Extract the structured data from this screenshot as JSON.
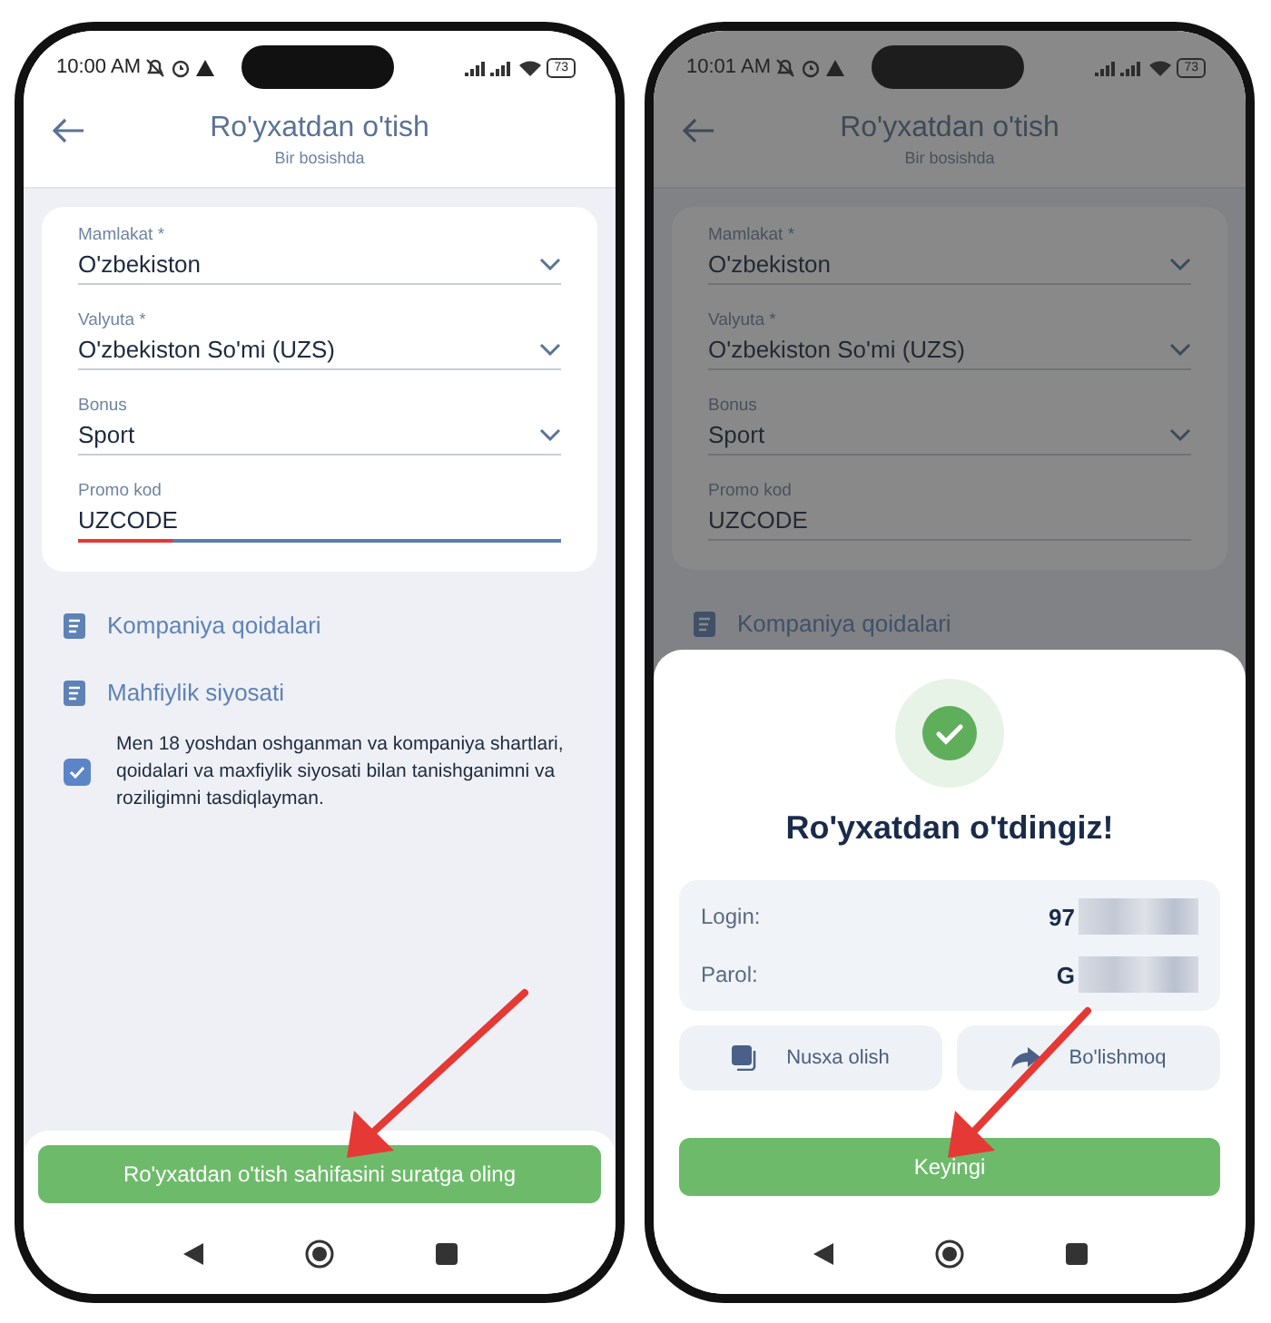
{
  "phones": [
    {
      "kind": "form",
      "dimmed": false,
      "status_bar": {
        "time": "10:00 AM",
        "battery": "73"
      },
      "header": {
        "title": "Ro'yxatdan o'tish",
        "subtitle": "Bir bosishda"
      },
      "fields": [
        {
          "kind": "select",
          "label": "Mamlakat *",
          "value": "O'zbekiston",
          "focused": false
        },
        {
          "kind": "select",
          "label": "Valyuta *",
          "value": "O'zbekiston So'mi (UZS)",
          "focused": false
        },
        {
          "kind": "select",
          "label": "Bonus",
          "value": "Sport",
          "focused": false
        },
        {
          "kind": "text",
          "label": "Promo kod",
          "value": "UZCODE",
          "focused": true
        }
      ],
      "links": [
        "Kompaniya qoidalari",
        "Mahfiylik siyosati"
      ],
      "agreement": {
        "text": "Men 18 yoshdan oshganman va kompaniya shartlari, qoidalari va maxfiylik siyosati bilan tanishganimni va roziligimni tasdiqlayman.",
        "checked": true
      },
      "footer_button": "Ro'yxatdan o'tish sahifasini suratga oling"
    },
    {
      "kind": "dialog",
      "dimmed": true,
      "status_bar": {
        "time": "10:01 AM",
        "battery": "73"
      },
      "header": {
        "title": "Ro'yxatdan o'tish",
        "subtitle": "Bir bosishda"
      },
      "fields": [
        {
          "kind": "select",
          "label": "Mamlakat *",
          "value": "O'zbekiston",
          "focused": false
        },
        {
          "kind": "select",
          "label": "Valyuta *",
          "value": "O'zbekiston So'mi (UZS)",
          "focused": false
        },
        {
          "kind": "select",
          "label": "Bonus",
          "value": "Sport",
          "focused": false
        },
        {
          "kind": "text",
          "label": "Promo kod",
          "value": "UZCODE",
          "focused": false
        }
      ],
      "links": [
        "Kompaniya qoidalari"
      ],
      "dialog": {
        "title": "Ro'yxatdan o'tdingiz!",
        "credentials": [
          {
            "label": "Login:",
            "value": "97"
          },
          {
            "label": "Parol:",
            "value": "G"
          }
        ],
        "actions": [
          {
            "kind": "copy",
            "label": "Nusxa olish"
          },
          {
            "kind": "share",
            "label": "Bo'lishmoq"
          }
        ],
        "next_button": "Keyingi"
      }
    }
  ]
}
